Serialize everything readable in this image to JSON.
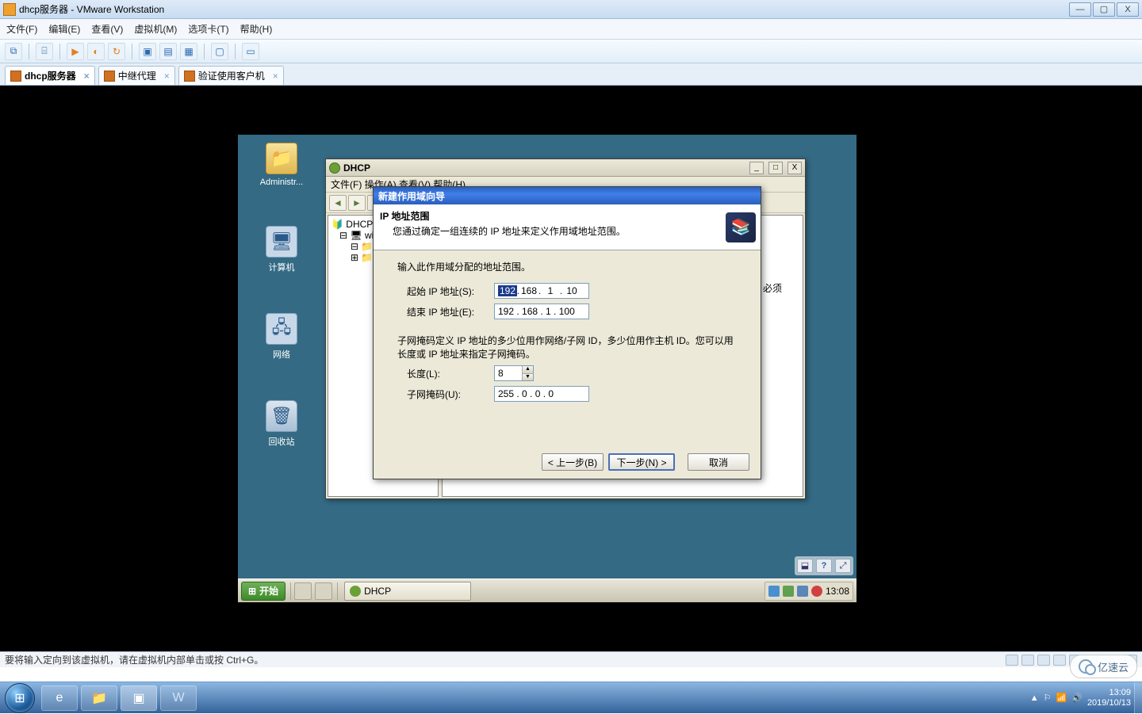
{
  "outer": {
    "title": "dhcp服务器 - VMware Workstation",
    "min": "—",
    "max": "▢",
    "close": "X"
  },
  "menubar": [
    "文件(F)",
    "编辑(E)",
    "查看(V)",
    "虚拟机(M)",
    "选项卡(T)",
    "帮助(H)"
  ],
  "tabs": [
    {
      "label": "dhcp服务器",
      "active": true
    },
    {
      "label": "中继代理",
      "active": false
    },
    {
      "label": "验证使用客户机",
      "active": false
    }
  ],
  "desktop": {
    "admin": "Administr...",
    "computer": "计算机",
    "network": "网络",
    "recycle": "回收站"
  },
  "mmc": {
    "title": "DHCP",
    "menu": " 文件(F)    操作(A)    查看(V)    帮助(H) ",
    "tree_root": "DHCP",
    "tree_srv": "win"
  },
  "wizard": {
    "title": "新建作用域向导",
    "h1": "IP 地址范围",
    "h2": "您通过确定一组连续的 IP 地址来定义作用域地址范围。",
    "intro": "输入此作用域分配的地址范围。",
    "start_label": "起始 IP 地址(S):",
    "start_ip": {
      "a": "192",
      "b": "168",
      "c": "1",
      "d": "10"
    },
    "end_label": "结束 IP 地址(E):",
    "end_ip": "192 . 168 .  1  . 100",
    "desc": "子网掩码定义 IP 地址的多少位用作网络/子网 ID，多少位用作主机 ID。您可以用长度或 IP 地址来指定子网掩码。",
    "len_label": "长度(L):",
    "len_value": "8",
    "mask_label": "子网掩码(U):",
    "mask_value": "255 .  0  .  0  .  0",
    "btn_back": "< 上一步(B)",
    "btn_next": "下一步(N) >",
    "btn_cancel": "取消"
  },
  "behind": "必须",
  "guest_taskbar": {
    "start": "开始",
    "task": "DHCP",
    "clock": "13:08"
  },
  "vmstatus": {
    "text": "要将输入定向到该虚拟机，请在虚拟机内部单击或按 Ctrl+G。"
  },
  "host_clock": {
    "time": "13:09",
    "date": "2019/10/13"
  },
  "watermark": "亿速云"
}
